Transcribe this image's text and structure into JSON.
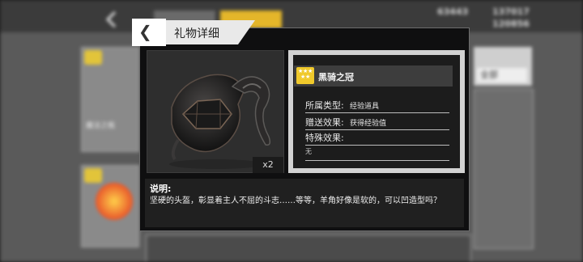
{
  "header": {
    "title": "礼物详细"
  },
  "item": {
    "name": "黑骑之冠",
    "rarity_stars": 3,
    "quantity": "x2",
    "image_icon": "horned-helmet-icon"
  },
  "properties": [
    {
      "label": "所属类型:",
      "value": "经验道具"
    },
    {
      "label": "赠送效果:",
      "value": "获得经验值"
    },
    {
      "label": "特殊效果:",
      "value": ""
    }
  ],
  "special_value": "无",
  "description": {
    "label": "说明:",
    "text": "坚硬的头盔，彰显着主人不屈的斗志……等等，羊角好像是软的，可以凹造型吗？"
  },
  "background": {
    "resource_1": "63443",
    "resource_2": "137017",
    "resource_3": "120856",
    "filter_label": "全部",
    "card_1_label": "魔法之瓶"
  },
  "colors": {
    "star_badge": "#f0c92b",
    "tab_accent": "#e4b62a"
  }
}
